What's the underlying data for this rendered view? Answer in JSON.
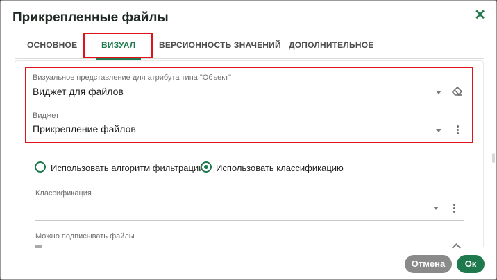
{
  "dialog": {
    "title": "Прикрепленные файлы",
    "close_glyph": "✕"
  },
  "tabs": [
    {
      "label": "ОСНОВНОЕ",
      "active": false
    },
    {
      "label": "ВИЗУАЛ",
      "active": true
    },
    {
      "label": "ВЕРСИОННОСТЬ ЗНАЧЕНИЙ",
      "active": false
    },
    {
      "label": "ДОПОЛНИТЕЛЬНОЕ",
      "active": false
    }
  ],
  "visual_fields": {
    "representation": {
      "label": "Визуальное представление для атрибута типа \"Объект\"",
      "value": "Виджет для файлов"
    },
    "widget": {
      "label": "Виджет",
      "value": "Прикрепление файлов"
    }
  },
  "filter_options": [
    {
      "label": "Использовать алгоритм фильтрации",
      "checked": false
    },
    {
      "label": "Использовать классификацию",
      "checked": true
    }
  ],
  "classification": {
    "label": "Классификация",
    "value": ""
  },
  "signing": {
    "label": "Можно подписывать файлы"
  },
  "footer": {
    "cancel_label": "Отмена",
    "ok_label": "Ок"
  },
  "colors": {
    "accent": "#1e7a4c",
    "highlight": "#e0131b",
    "cancel_bg": "#8a8a8a"
  },
  "icons": {
    "close": "close-icon",
    "caret": "chevron-down-icon",
    "clear": "eraser-icon",
    "menu": "kebab-menu-icon",
    "collapse": "chevron-up-icon"
  }
}
